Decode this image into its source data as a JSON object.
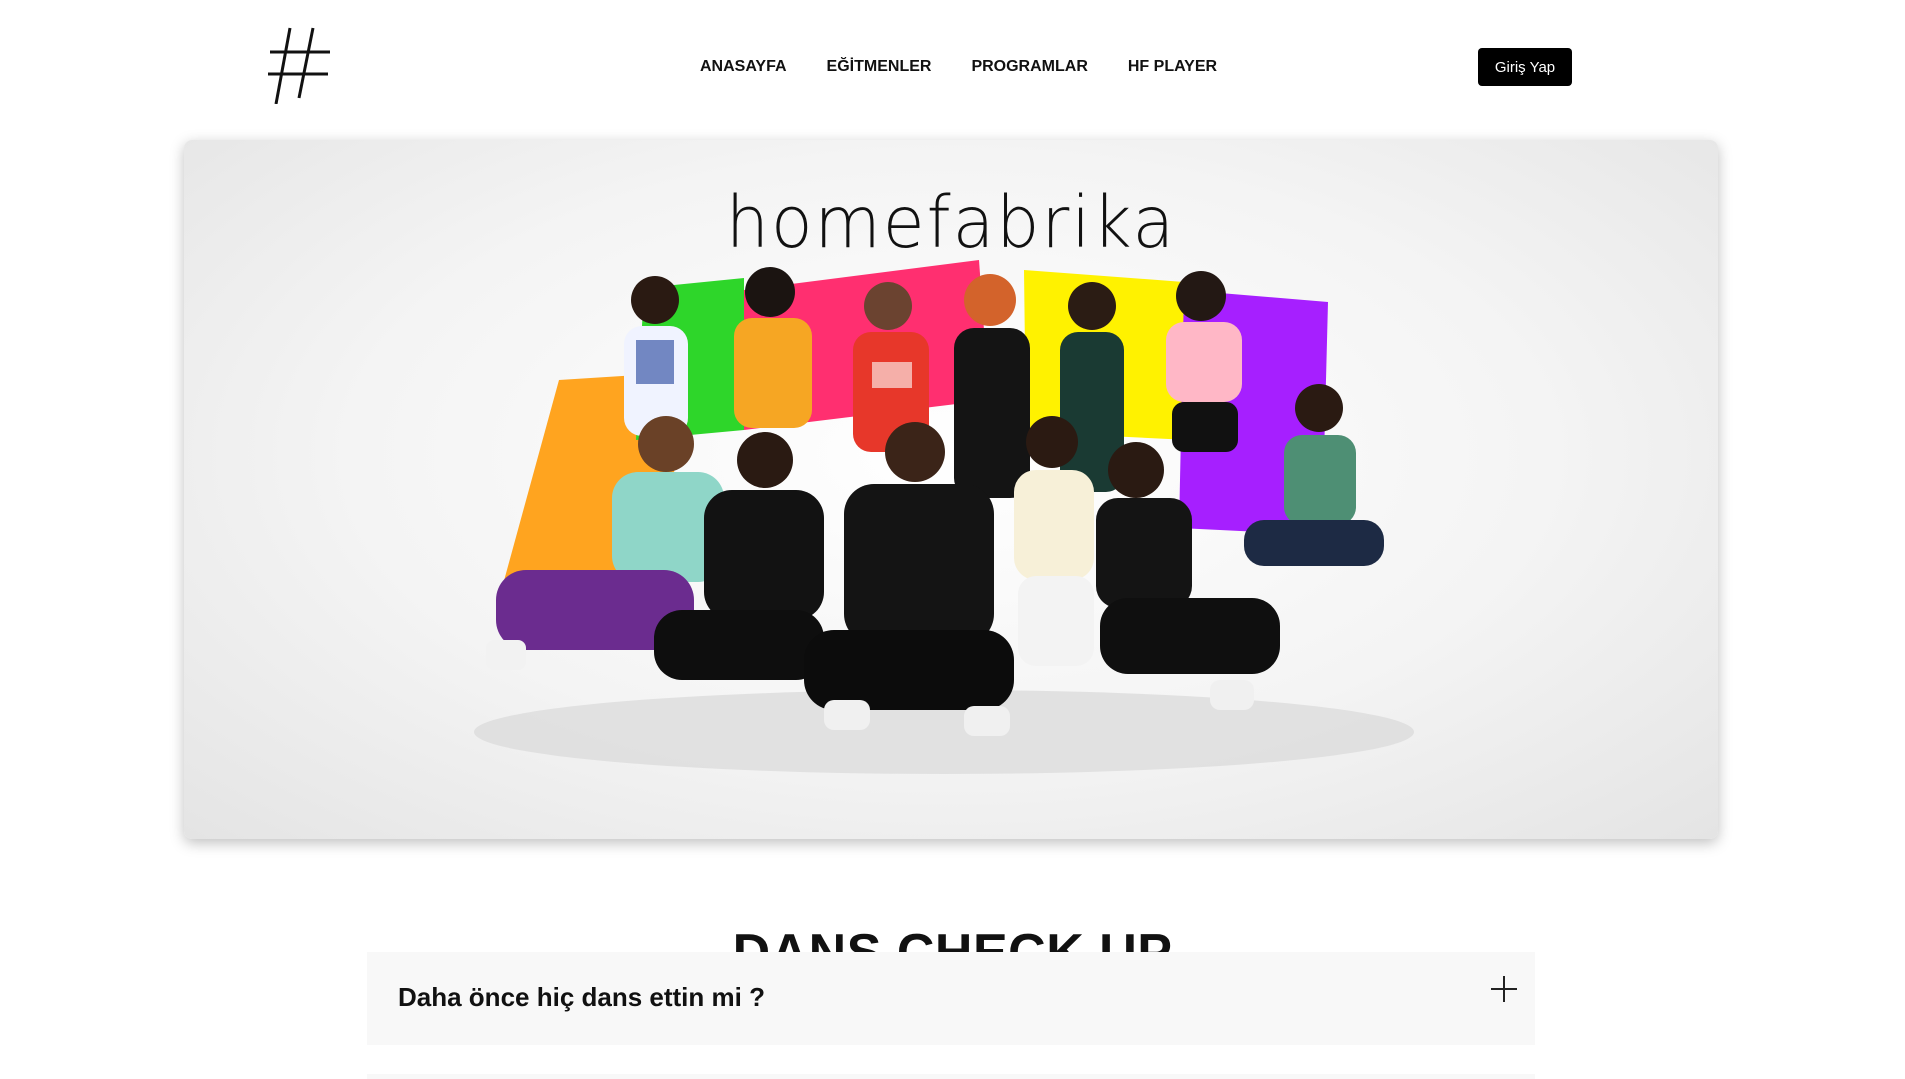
{
  "nav": {
    "logo_icon": "hash-logo-icon",
    "items": [
      {
        "label": "ANASAYFA"
      },
      {
        "label": "EĞİTMENLER"
      },
      {
        "label": "PROGRAMLAR"
      },
      {
        "label": "HF PLAYER"
      }
    ],
    "login_label": "Giriş Yap"
  },
  "hero": {
    "brand": "homefabrika",
    "image_description_colors": [
      "#ff9f1a",
      "#2fd92b",
      "#ff2d6e",
      "#ffee00",
      "#a21dff"
    ]
  },
  "section": {
    "title": "DANS CHECK UP"
  },
  "faq": [
    {
      "question": "Daha önce hiç dans ettin mi ?",
      "toggle_icon": "plus-icon"
    }
  ]
}
